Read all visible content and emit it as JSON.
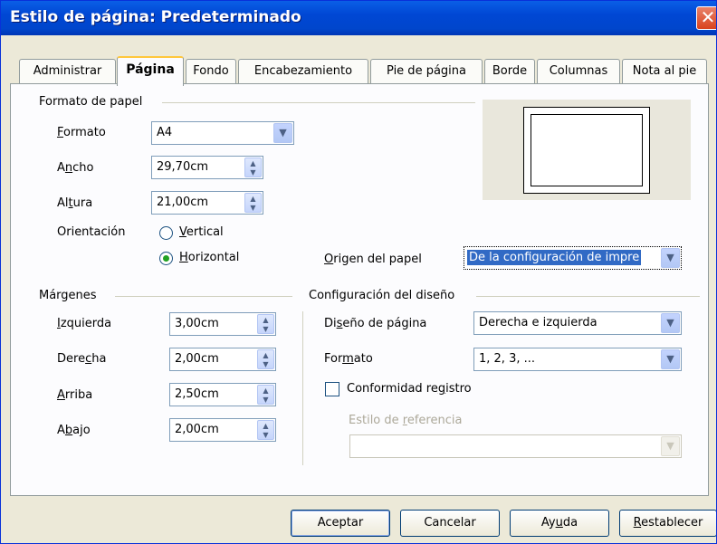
{
  "window": {
    "title": "Estilo de página: Predeterminado",
    "close_glyph": "✕"
  },
  "tabs": [
    {
      "label": "Administrar"
    },
    {
      "label": "Página"
    },
    {
      "label": "Fondo"
    },
    {
      "label": "Encabezamiento"
    },
    {
      "label": "Pie de página"
    },
    {
      "label": "Borde"
    },
    {
      "label": "Columnas"
    },
    {
      "label": "Nota al pie"
    }
  ],
  "paper_format": {
    "section_label": "Formato de papel",
    "format_label": "Formato",
    "format_value": "A4",
    "width_label": "Ancho",
    "width_value": "29,70cm",
    "height_label": "Altura",
    "height_value": "21,00cm",
    "orientation_label": "Orientación",
    "orientation_options": [
      "Vertical",
      "Horizontal"
    ],
    "orientation_selected": "Horizontal",
    "paper_source_label": "Origen del papel",
    "paper_source_value": "De la configuración de impre"
  },
  "margins": {
    "section_label": "Márgenes",
    "left_label": "Izquierda",
    "left_value": "3,00cm",
    "right_label": "Derecha",
    "right_value": "2,00cm",
    "top_label": "Arriba",
    "top_value": "2,50cm",
    "bottom_label": "Abajo",
    "bottom_value": "2,00cm"
  },
  "layout": {
    "section_label": "Configuración del diseño",
    "page_layout_label": "Diseño de página",
    "page_layout_value": "Derecha e izquierda",
    "format_label": "Formato",
    "format_value": "1, 2, 3, ...",
    "register_true_label": "Conformidad registro",
    "register_true_checked": false,
    "reference_style_label": "Estilo de referencia",
    "reference_style_value": ""
  },
  "buttons": {
    "ok": "Aceptar",
    "cancel": "Cancelar",
    "help": "Ayuda",
    "reset": "Restablecer"
  },
  "colors": {
    "titlebar": "#0054e3",
    "dialog_bg": "#ece9d8",
    "active_tab_accent": "#ffc73c",
    "radio_dot": "#21a121"
  }
}
